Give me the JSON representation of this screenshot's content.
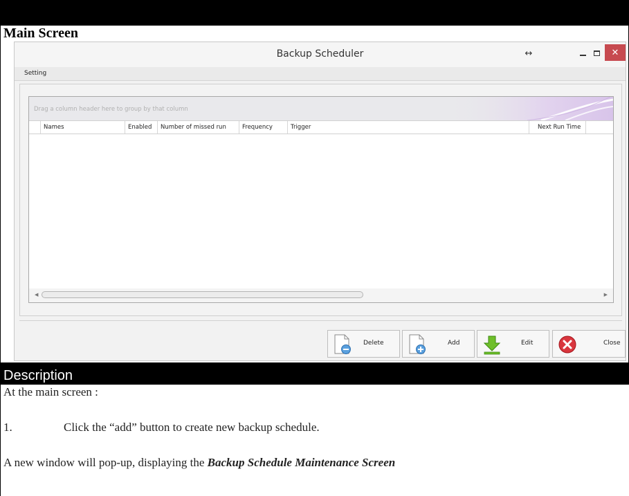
{
  "document": {
    "section_title": "Main Screen",
    "description_title": "Description",
    "intro": "At the main screen :",
    "step_number": "1.",
    "step_text": "Click the “add” button to create new backup schedule.",
    "popup_text": "A new window will pop-up, displaying the ",
    "popup_emphasis": "Backup Schedule Maintenance Screen"
  },
  "window": {
    "title": "Backup Scheduler",
    "resize_glyph": "↔",
    "close_glyph": "✕",
    "menu": [
      "Setting"
    ]
  },
  "grid": {
    "group_hint": "Drag a column header here to group by that column",
    "columns": [
      "Names",
      "Enabled",
      "Number of missed run",
      "Frequency",
      "Trigger",
      "Next Run Time"
    ],
    "rows": []
  },
  "buttons": {
    "delete": {
      "label": "Delete",
      "icon": "document-minus-icon"
    },
    "add": {
      "label": "Add",
      "icon": "document-plus-icon"
    },
    "edit": {
      "label": "Edit",
      "icon": "green-down-arrow-icon"
    },
    "close": {
      "label": "Close",
      "icon": "red-x-circle-icon"
    }
  },
  "colors": {
    "close_button": "#c74a50",
    "section_bar": "#000000",
    "edit_icon": "#6fbf2a",
    "close_icon": "#d9363e",
    "doc_icon_accent": "#3f8fd6"
  }
}
